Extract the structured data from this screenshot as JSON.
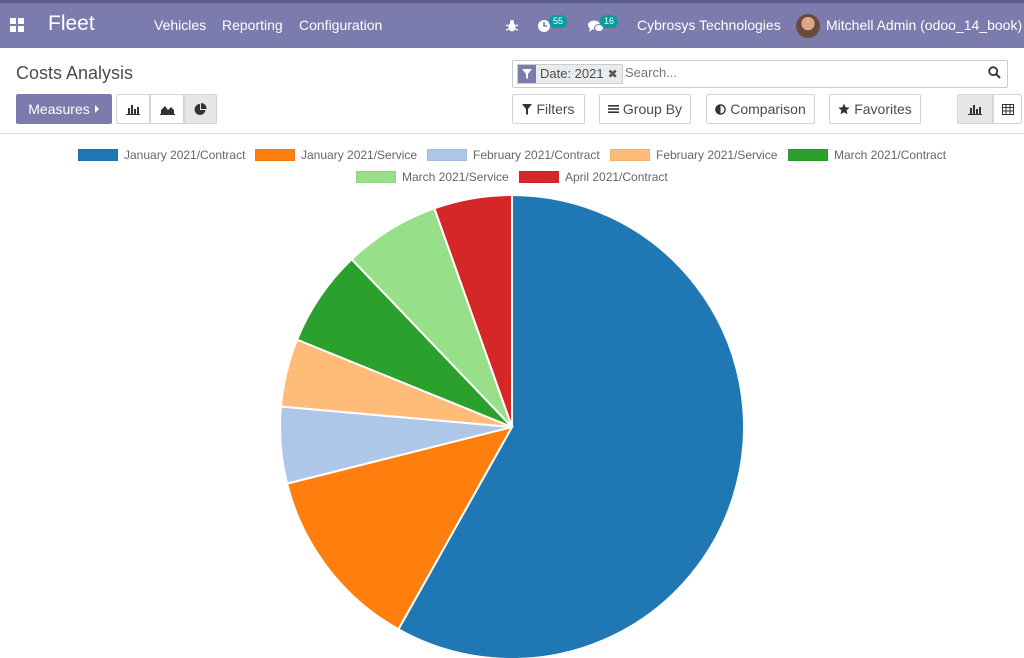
{
  "app": {
    "brand": "Fleet"
  },
  "menu": [
    "Vehicles",
    "Reporting",
    "Configuration"
  ],
  "systray": {
    "activity_count": "55",
    "message_count": "16",
    "company": "Cybrosys Technologies",
    "user": "Mitchell Admin (odoo_14_book)"
  },
  "page": {
    "title": "Costs Analysis"
  },
  "search": {
    "facet_value": "Date: 2021",
    "placeholder": "Search..."
  },
  "toolbar": {
    "measures_label": "Measures",
    "filters_label": "Filters",
    "groupby_label": "Group By",
    "comparison_label": "Comparison",
    "favorites_label": "Favorites"
  },
  "colors": {
    "navbar": "#7c7bad",
    "badge": "#00a09d"
  },
  "chart_data": {
    "type": "pie",
    "legend_placement": "top",
    "series": [
      {
        "name": "January 2021/Contract",
        "value": 58.9,
        "color": "#1f77b4"
      },
      {
        "name": "January 2021/Service",
        "value": 13.1,
        "color": "#ff7f0e"
      },
      {
        "name": "February 2021/Contract",
        "value": 5.4,
        "color": "#aec7e8"
      },
      {
        "name": "February 2021/Service",
        "value": 4.8,
        "color": "#ffbb78"
      },
      {
        "name": "March 2021/Contract",
        "value": 6.8,
        "color": "#2ca02c"
      },
      {
        "name": "March 2021/Service",
        "value": 6.8,
        "color": "#98df8a"
      },
      {
        "name": "April 2021/Contract",
        "value": 5.5,
        "color": "#d62728"
      }
    ]
  }
}
